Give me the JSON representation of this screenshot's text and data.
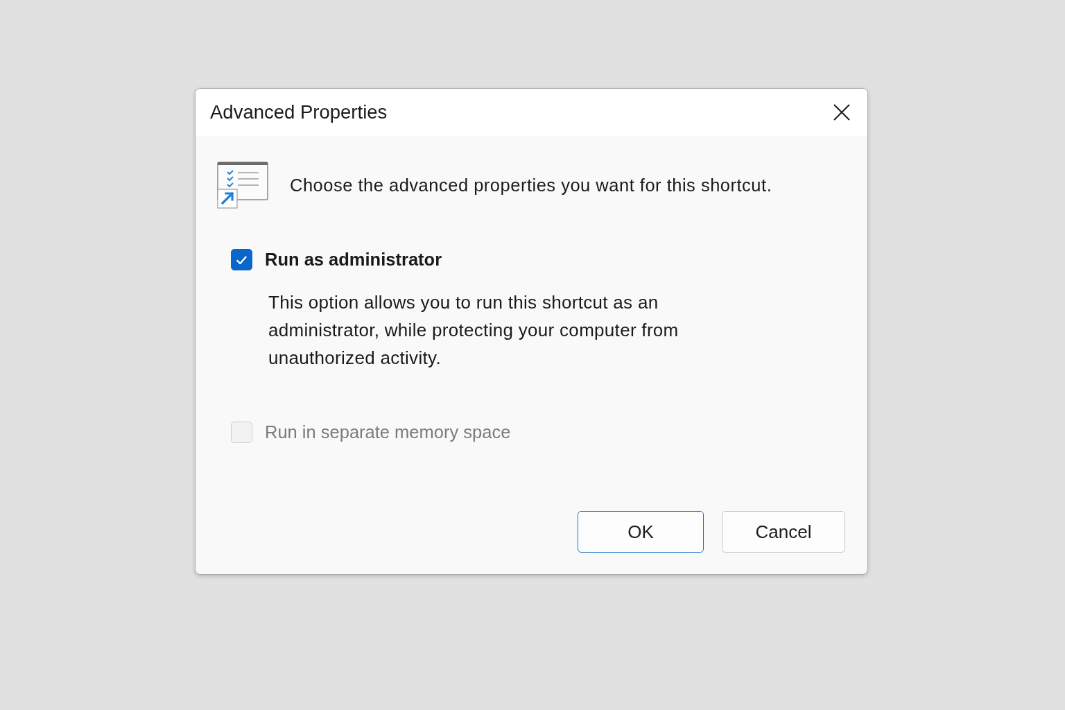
{
  "window": {
    "title": "Advanced Properties"
  },
  "intro": "Choose the advanced properties you want for this shortcut.",
  "options": [
    {
      "kind": "checkbox",
      "label": "Run as administrator",
      "checked": true,
      "disabled": false,
      "description": "This option allows you to run this shortcut as an administrator, while protecting your computer from unauthorized activity."
    },
    {
      "kind": "checkbox",
      "label": "Run in separate memory space",
      "checked": false,
      "disabled": true
    }
  ],
  "buttons": [
    {
      "label": "OK",
      "default": true
    },
    {
      "label": "Cancel",
      "default": false
    }
  ]
}
